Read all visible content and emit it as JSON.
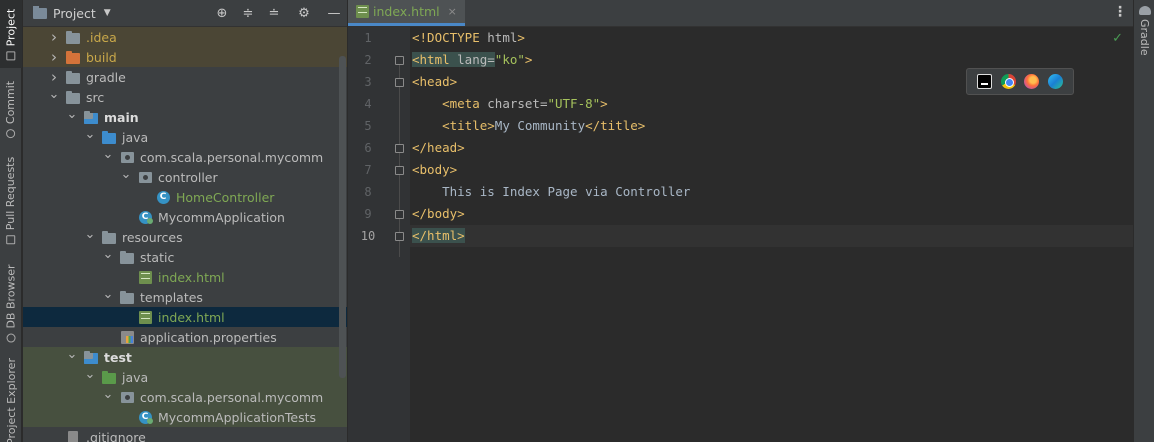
{
  "left_strip": {
    "tabs": [
      {
        "label": "Project",
        "icon": "folder-icon"
      },
      {
        "label": "Commit",
        "icon": "commit-icon"
      },
      {
        "label": "Pull Requests",
        "icon": "pull-request-icon"
      },
      {
        "label": "DB Browser",
        "icon": "database-icon"
      },
      {
        "label": "Project Explorer",
        "icon": "explorer-icon"
      }
    ]
  },
  "project_panel": {
    "title": "Project",
    "tools": [
      "locate-icon",
      "expand-all-icon",
      "collapse-all-icon",
      "gear-icon",
      "hide-icon"
    ],
    "tree": [
      {
        "label": ".idea",
        "depth": 1,
        "expanded": false,
        "icon": "folder-grey",
        "style": "excl"
      },
      {
        "label": "build",
        "depth": 1,
        "expanded": false,
        "icon": "folder-orange",
        "style": "excl"
      },
      {
        "label": "gradle",
        "depth": 1,
        "expanded": false,
        "icon": "folder-grey",
        "style": "normal"
      },
      {
        "label": "src",
        "depth": 1,
        "expanded": true,
        "icon": "folder-grey",
        "style": "normal"
      },
      {
        "label": "main",
        "depth": 2,
        "expanded": true,
        "icon": "folder-module",
        "style": "bold"
      },
      {
        "label": "java",
        "depth": 3,
        "expanded": true,
        "icon": "folder-blue",
        "style": "normal"
      },
      {
        "label": "com.scala.personal.mycomm",
        "depth": 4,
        "expanded": true,
        "icon": "package",
        "style": "normal"
      },
      {
        "label": "controller",
        "depth": 5,
        "expanded": true,
        "icon": "package",
        "style": "normal"
      },
      {
        "label": "HomeController",
        "depth": 6,
        "expanded": null,
        "icon": "class",
        "style": "green"
      },
      {
        "label": "MycommApplication",
        "depth": 5,
        "expanded": null,
        "icon": "spring-class",
        "style": "normal"
      },
      {
        "label": "resources",
        "depth": 3,
        "expanded": true,
        "icon": "folder-res",
        "style": "normal"
      },
      {
        "label": "static",
        "depth": 4,
        "expanded": true,
        "icon": "folder-grey",
        "style": "normal"
      },
      {
        "label": "index.html",
        "depth": 5,
        "expanded": null,
        "icon": "html",
        "style": "html"
      },
      {
        "label": "templates",
        "depth": 4,
        "expanded": true,
        "icon": "folder-grey",
        "style": "normal"
      },
      {
        "label": "index.html",
        "depth": 5,
        "expanded": null,
        "icon": "html",
        "style": "html",
        "selected": true
      },
      {
        "label": "application.properties",
        "depth": 4,
        "expanded": null,
        "icon": "props",
        "style": "normal"
      },
      {
        "label": "test",
        "depth": 2,
        "expanded": true,
        "icon": "folder-module",
        "style": "bold"
      },
      {
        "label": "java",
        "depth": 3,
        "expanded": true,
        "icon": "folder-green",
        "style": "normal",
        "test": true
      },
      {
        "label": "com.scala.personal.mycomm",
        "depth": 4,
        "expanded": true,
        "icon": "package",
        "style": "normal",
        "test": true
      },
      {
        "label": "MycommApplicationTests",
        "depth": 5,
        "expanded": null,
        "icon": "spring-class",
        "style": "normal",
        "test": true
      },
      {
        "label": ".gitignore",
        "depth": 1,
        "expanded": null,
        "icon": "file",
        "style": "normal"
      }
    ]
  },
  "editor": {
    "tab": {
      "label": "index.html",
      "close": "×"
    },
    "line_numbers": [
      "1",
      "2",
      "3",
      "4",
      "5",
      "6",
      "7",
      "8",
      "9",
      "10"
    ],
    "lines": [
      [
        [
          "tag",
          "<!DOCTYPE "
        ],
        [
          "attr",
          "html"
        ],
        [
          "tag",
          ">"
        ]
      ],
      [
        [
          "tag",
          "<html "
        ],
        [
          "attr",
          "lang="
        ],
        [
          "str",
          "\"ko\""
        ],
        [
          "tag",
          ">"
        ]
      ],
      [
        [
          "tag",
          "<head>"
        ]
      ],
      [
        [
          "txt",
          "    "
        ],
        [
          "tag",
          "<meta "
        ],
        [
          "attr",
          "charset="
        ],
        [
          "str",
          "\"UTF-8\""
        ],
        [
          "tag",
          ">"
        ]
      ],
      [
        [
          "txt",
          "    "
        ],
        [
          "tag",
          "<title>"
        ],
        [
          "txt",
          "My Community"
        ],
        [
          "tag",
          "</title>"
        ]
      ],
      [
        [
          "tag",
          "</head>"
        ]
      ],
      [
        [
          "tag",
          "<body>"
        ]
      ],
      [
        [
          "txt",
          "    This is Index Page via Controller"
        ]
      ],
      [
        [
          "tag",
          "</body>"
        ]
      ],
      [
        [
          "tag",
          "</html>"
        ]
      ]
    ],
    "current_line": 10,
    "browsers": [
      "intellij-icon",
      "chrome-icon",
      "firefox-icon",
      "edge-icon"
    ]
  },
  "right_strip": {
    "label": "Gradle",
    "icon": "gradle-icon"
  }
}
